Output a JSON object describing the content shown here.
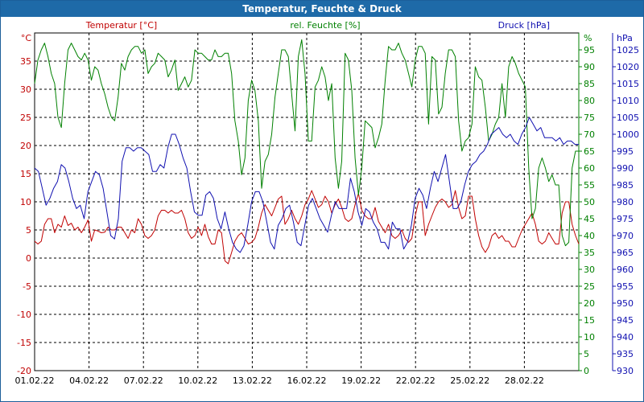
{
  "chart_data": {
    "type": "line",
    "title": "Temperatur, Feuchte & Druck",
    "x": [
      "01.02.22",
      "04.02.22",
      "07.02.22",
      "10.02.22",
      "13.02.22",
      "16.02.22",
      "19.02.22",
      "22.02.22",
      "25.02.22",
      "28.02.22"
    ],
    "axes": {
      "left": {
        "label": "Temperatur [°C]",
        "unit": "°C",
        "ylim": [
          -20,
          40
        ],
        "ticks": [
          -20,
          -15,
          -10,
          -5,
          0,
          5,
          10,
          15,
          20,
          25,
          30,
          35
        ],
        "color": "#c00000"
      },
      "right1": {
        "label": "rel. Feuchte [%]",
        "unit": "%",
        "ylim": [
          0,
          100
        ],
        "ticks": [
          0,
          5,
          10,
          15,
          20,
          25,
          30,
          35,
          40,
          45,
          50,
          55,
          60,
          65,
          70,
          75,
          80,
          85,
          90,
          95
        ],
        "color": "#008000"
      },
      "right2": {
        "label": "Druck [hPa]",
        "unit": "hPa",
        "ylim": [
          930,
          1030
        ],
        "ticks": [
          930,
          935,
          940,
          945,
          950,
          955,
          960,
          965,
          970,
          975,
          980,
          985,
          990,
          995,
          1000,
          1005,
          1010,
          1015,
          1020,
          1025
        ],
        "color": "#1010b0"
      }
    },
    "grid": true,
    "series": [
      {
        "name": "Temperatur [°C]",
        "axis": "left",
        "color": "#c00000",
        "values": [
          3,
          2.5,
          3,
          6,
          7,
          7,
          4.5,
          6,
          5.5,
          7.5,
          5.8,
          6.2,
          5,
          5.5,
          4.5,
          5.5,
          6.8,
          3,
          5,
          4.8,
          4.5,
          4.6,
          5.5,
          5,
          5,
          5.5,
          5.5,
          4.5,
          3.5,
          5,
          4.5,
          7,
          6,
          4,
          3.5,
          4,
          5,
          7.5,
          8.5,
          8.5,
          8,
          8.5,
          8,
          8,
          8.5,
          7,
          4.5,
          3.5,
          4,
          5.5,
          4,
          6,
          3.8,
          2.5,
          2.5,
          5,
          4.5,
          -0.5,
          -1,
          1,
          3,
          4,
          4.5,
          3.5,
          2.5,
          2.8,
          3.5,
          5.5,
          8,
          9.5,
          8.5,
          7.5,
          9,
          10.5,
          11,
          6,
          7,
          8.5,
          7,
          6,
          7.5,
          9.5,
          10.5,
          12,
          10.5,
          9,
          9.5,
          11,
          10,
          8,
          9.5,
          10.5,
          9,
          7,
          6.5,
          7,
          9.5,
          11.5,
          8.5,
          7.5,
          7,
          7,
          9,
          6.5,
          5.5,
          4.5,
          6,
          4,
          3.5,
          4,
          5,
          3.5,
          2.8,
          3.5,
          7.5,
          10,
          10,
          4,
          6,
          7.5,
          9,
          10,
          10.5,
          10,
          9,
          9.5,
          12,
          9,
          7,
          7.5,
          11,
          11,
          7,
          4,
          2,
          1,
          2,
          4,
          4.5,
          3.5,
          4,
          3,
          3,
          2,
          2,
          3.5,
          5,
          6,
          7,
          8,
          6,
          3,
          2.5,
          3,
          4.5,
          3.5,
          2.5,
          2.5,
          8,
          10,
          10,
          6,
          4,
          2.5
        ]
      },
      {
        "name": "rel. Feuchte [%]",
        "axis": "right1",
        "color": "#008000",
        "values": [
          85,
          92,
          95,
          97,
          93,
          88,
          85,
          75,
          72,
          85,
          95,
          97,
          95,
          93,
          92,
          94,
          92,
          86,
          90,
          89,
          85,
          82,
          78,
          75,
          74,
          81,
          91,
          89,
          93,
          95,
          96,
          96,
          94,
          95,
          88,
          90,
          91,
          94,
          93,
          92,
          87,
          89,
          92,
          83,
          85,
          87,
          84,
          86,
          95,
          94,
          94,
          93,
          92,
          92,
          95,
          93,
          93,
          94,
          94,
          88,
          74,
          68,
          58,
          63,
          80,
          86,
          83,
          74,
          54,
          62,
          64,
          70,
          81,
          88,
          95,
          95,
          93,
          82,
          71,
          93,
          98,
          88,
          68,
          68,
          84,
          86,
          90,
          87,
          80,
          85,
          63,
          54,
          62,
          94,
          92,
          83,
          63,
          52,
          60,
          74,
          73,
          72,
          66,
          69,
          73,
          86,
          96,
          95,
          95,
          97,
          94,
          92,
          88,
          84,
          92,
          96,
          96,
          94,
          73,
          93,
          92,
          76,
          78,
          88,
          95,
          95,
          93,
          74,
          65,
          68,
          69,
          73,
          90,
          87,
          86,
          78,
          68,
          70,
          73,
          75,
          85,
          75,
          90,
          93,
          91,
          88,
          86,
          84,
          60,
          45,
          48,
          60,
          63,
          60,
          56,
          58,
          55,
          55,
          40,
          37,
          38,
          60,
          65,
          65
        ]
      },
      {
        "name": "Druck [hPa]",
        "axis": "right2",
        "color": "#1010b0",
        "values": [
          990,
          989,
          984,
          979,
          981,
          984,
          986,
          991,
          990,
          986,
          981,
          978,
          979,
          975,
          983,
          986,
          989,
          988,
          984,
          977,
          970,
          969,
          975,
          992,
          996,
          996,
          995,
          996,
          996,
          995,
          994,
          989,
          989,
          991,
          990,
          996,
          1000,
          1000,
          997,
          993,
          990,
          983,
          977,
          976,
          976,
          982,
          983,
          981,
          975,
          972,
          977,
          972,
          968,
          966,
          965,
          967,
          973,
          980,
          983,
          983,
          980,
          974,
          968,
          966,
          973,
          975,
          978,
          979,
          974,
          968,
          967,
          973,
          979,
          981,
          978,
          975,
          973,
          971,
          976,
          980,
          978,
          978,
          978,
          987,
          983,
          977,
          973,
          978,
          977,
          974,
          972,
          968,
          968,
          966,
          974,
          972,
          972,
          966,
          968,
          973,
          981,
          984,
          982,
          978,
          984,
          989,
          986,
          990,
          994,
          986,
          978,
          978,
          980,
          985,
          989,
          991,
          992,
          994,
          995,
          997,
          1000,
          1001,
          1002,
          1000,
          999,
          1000,
          998,
          997,
          1000,
          1002,
          1005,
          1003,
          1001,
          1002,
          999,
          999,
          999,
          998,
          999,
          997,
          998,
          998,
          997,
          997
        ]
      }
    ]
  }
}
